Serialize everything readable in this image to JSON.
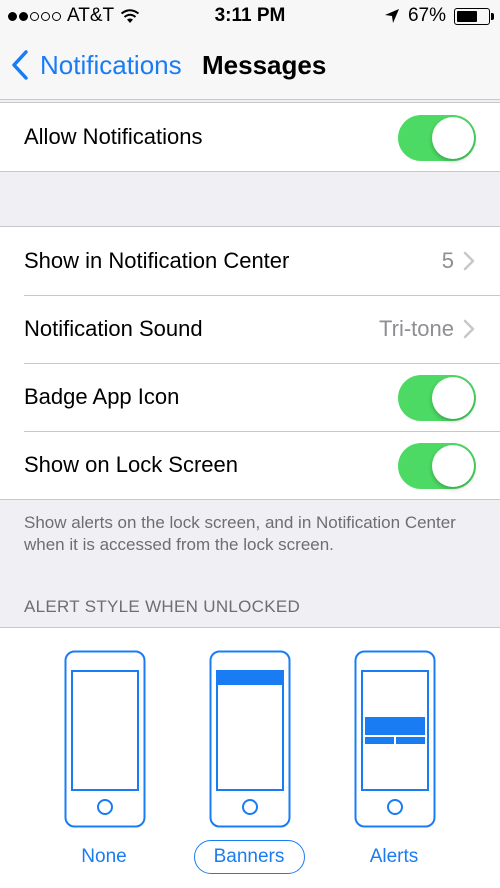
{
  "status_bar": {
    "carrier": "AT&T",
    "time": "3:11 PM",
    "battery": "67%",
    "battery_level": 0.67,
    "signal_bars_filled": 2,
    "signal_bars_total": 5
  },
  "nav": {
    "back_label": "Notifications",
    "title": "Messages"
  },
  "allow_notifications": {
    "label": "Allow Notifications",
    "on": true
  },
  "settings": {
    "show_in_center": {
      "label": "Show in Notification Center",
      "value": "5"
    },
    "sound": {
      "label": "Notification Sound",
      "value": "Tri-tone"
    },
    "badge": {
      "label": "Badge App Icon",
      "on": true
    },
    "lock_screen": {
      "label": "Show on Lock Screen",
      "on": true
    }
  },
  "lock_screen_note": "Show alerts on the lock screen, and in Notification Center when it is accessed from the lock screen.",
  "alert_style": {
    "header": "ALERT STYLE WHEN UNLOCKED",
    "options": [
      "None",
      "Banners",
      "Alerts"
    ],
    "selected": "Banners"
  },
  "colors": {
    "accent": "#1a7cf3",
    "toggle_on": "#4cd964"
  },
  "icons": {
    "back": "chevron-left-icon",
    "disclosure": "chevron-right-icon",
    "wifi": "wifi-icon",
    "location": "location-arrow-icon",
    "battery": "battery-icon"
  }
}
